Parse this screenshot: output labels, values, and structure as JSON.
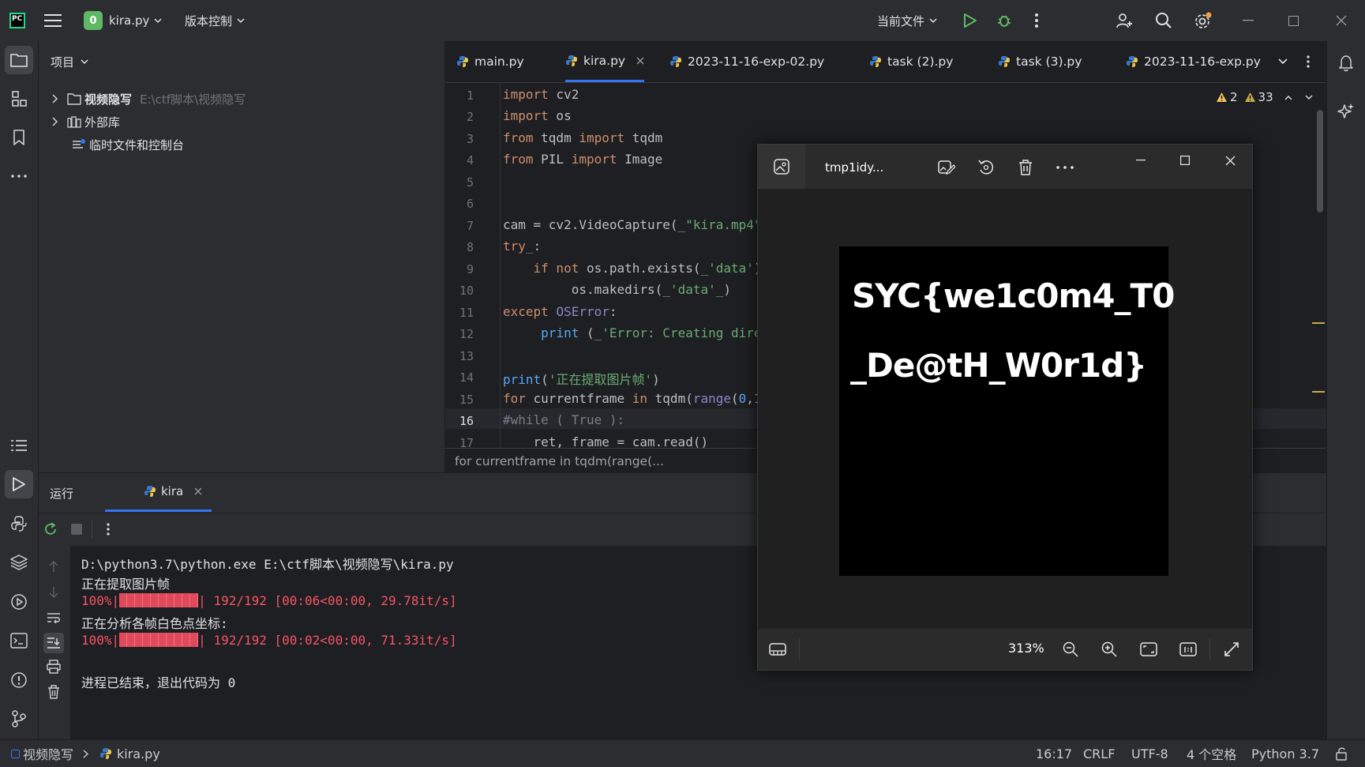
{
  "titlebar": {
    "logo_text": "PC",
    "project_label": "kira.py",
    "project_initial": "0",
    "vcs_label": "版本控制",
    "run_config_label": "当前文件"
  },
  "project_panel": {
    "title": "项目",
    "tree": [
      {
        "label": "视频隐写",
        "path": "E:\\ctf脚本\\视频隐写"
      },
      {
        "label": "外部库",
        "path": ""
      },
      {
        "label": "临时文件和控制台",
        "path": ""
      }
    ]
  },
  "editor": {
    "tabs": [
      {
        "label": "main.py"
      },
      {
        "label": "kira.py",
        "closable": true
      },
      {
        "label": "2023-11-16-exp-02.py"
      },
      {
        "label": "task (2).py"
      },
      {
        "label": "task (3).py"
      },
      {
        "label": "2023-11-16-exp.py"
      }
    ],
    "warnings": {
      "errors_count": "2",
      "warnings_count": "33"
    },
    "line_numbers": [
      "1",
      "2",
      "3",
      "4",
      "5",
      "6",
      "7",
      "8",
      "9",
      "10",
      "11",
      "12",
      "13",
      "14",
      "15",
      "16",
      "17"
    ],
    "breadcrumb": "for currentframe in tqdm(range(..."
  },
  "run_panel": {
    "title": "运行",
    "tab_label": "kira",
    "console": {
      "line1": "D:\\python3.7\\python.exe E:\\ctf脚本\\视频隐写\\kira.py",
      "line2": "正在提取图片帧",
      "line3_pct": "100%|",
      "line3_rest": "| 192/192 [00:06<00:00, 29.78it/s]",
      "line4": "正在分析各帧白色点坐标:",
      "line5_pct": "100%|",
      "line5_rest": "| 192/192 [00:02<00:00, 71.33it/s]",
      "line6": "进程已结束，退出代码为 0"
    }
  },
  "viewer": {
    "title": "tmp1idy...",
    "zoom": "313%",
    "image_text_line1": "SYC{we1c0m4_T0",
    "image_text_line2": "_De@tH_W0r1d}"
  },
  "statusbar": {
    "project": "视频隐写",
    "file": "kira.py",
    "position": "16:17",
    "line_sep": "CRLF",
    "encoding": "UTF-8",
    "indent": "4 个空格",
    "interpreter": "Python 3.7"
  },
  "colors": {
    "accent": "#3574f0",
    "console_red": "#f75464",
    "keyword": "#cf8e6d",
    "string": "#6aab73"
  }
}
